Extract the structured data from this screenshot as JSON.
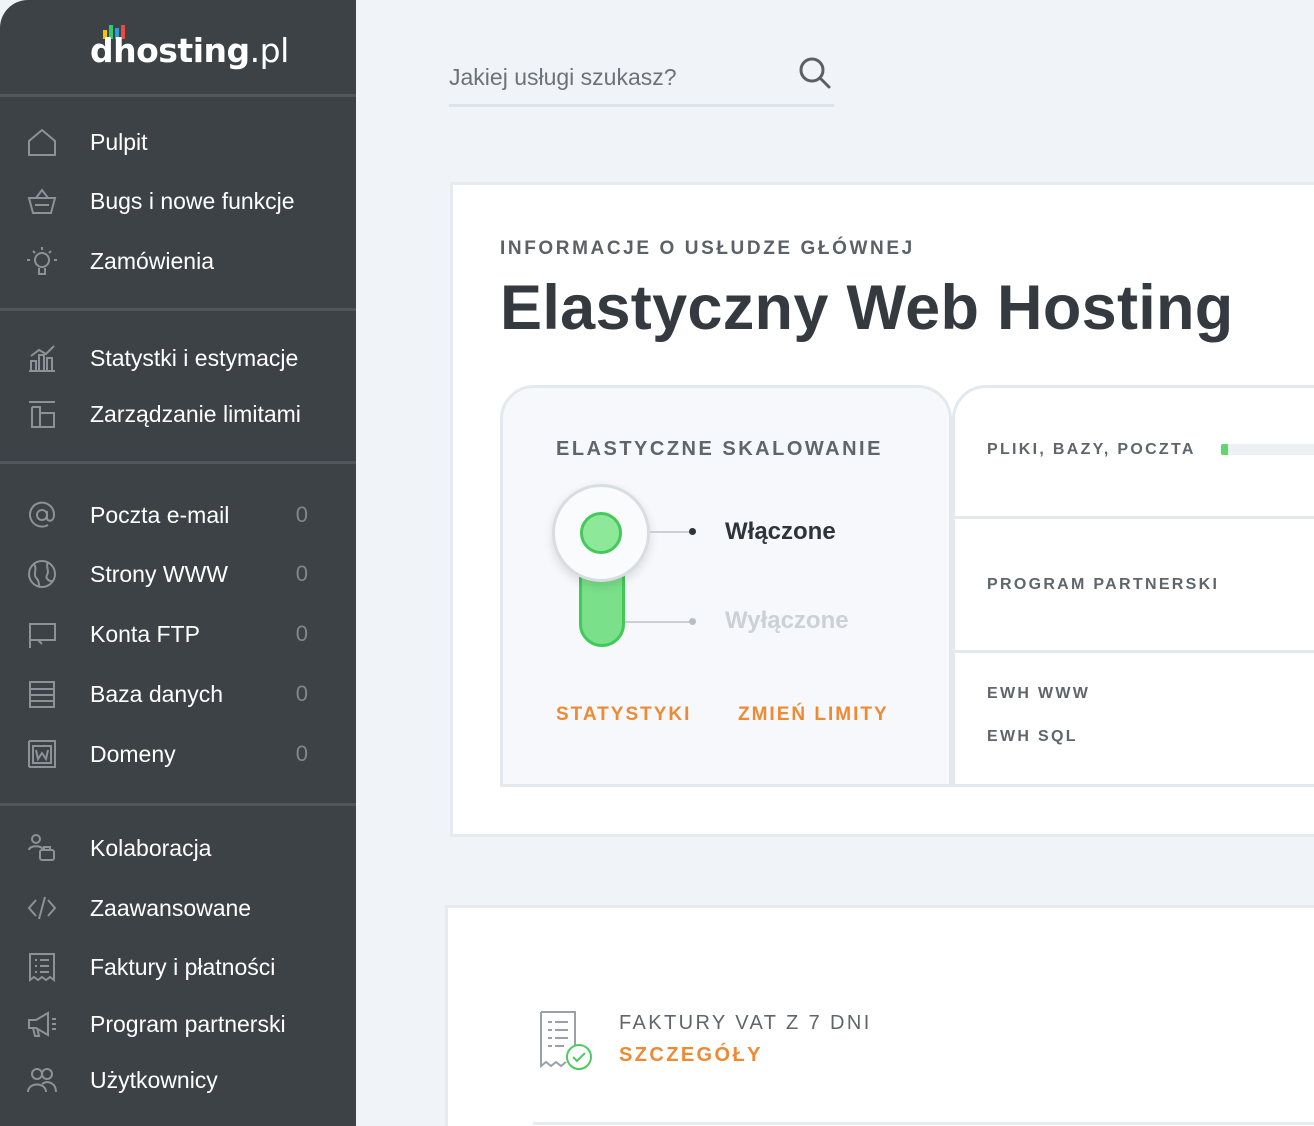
{
  "brand": {
    "logo_main": "dhosting",
    "logo_suffix": ".pl",
    "bar_colors": [
      "#f5c300",
      "#2ecc71",
      "#3498db",
      "#e74c3c"
    ]
  },
  "search": {
    "placeholder": "Jakiej usługi szukasz?"
  },
  "sidebar": {
    "group1": [
      {
        "label": "Pulpit",
        "icon": "home-icon"
      },
      {
        "label": "Bugs i nowe funkcje",
        "icon": "basket-icon"
      },
      {
        "label": "Zamówienia",
        "icon": "lightbulb-icon"
      }
    ],
    "group2": [
      {
        "label": "Statystki i estymacje",
        "icon": "chart-icon"
      },
      {
        "label": "Zarządzanie limitami",
        "icon": "limits-icon"
      }
    ],
    "group3": [
      {
        "label": "Poczta e-mail",
        "icon": "at-icon",
        "count": "0"
      },
      {
        "label": "Strony WWW",
        "icon": "globe-icon",
        "count": "0"
      },
      {
        "label": "Konta FTP",
        "icon": "ftp-icon",
        "count": "0"
      },
      {
        "label": "Baza danych",
        "icon": "database-icon",
        "count": "0"
      },
      {
        "label": "Domeny",
        "icon": "domain-icon",
        "count": "0"
      }
    ],
    "group4": [
      {
        "label": "Kolaboracja",
        "icon": "collaboration-icon"
      },
      {
        "label": "Zaawansowane",
        "icon": "code-icon"
      },
      {
        "label": "Faktury i płatności",
        "icon": "invoice-icon"
      },
      {
        "label": "Program partnerski",
        "icon": "megaphone-icon"
      },
      {
        "label": "Użytkownicy",
        "icon": "users-icon"
      }
    ]
  },
  "service": {
    "eyebrow": "INFORMACJE O USŁUDZE GŁÓWNEJ",
    "title": "Elastyczny Web Hosting"
  },
  "scaling": {
    "title": "ELASTYCZNE SKALOWANIE",
    "on_label": "Włączone",
    "off_label": "Wyłączone",
    "state": "on",
    "stats_link": "STATYSTYKI",
    "limits_link": "ZMIEŃ LIMITY",
    "accent": "#ee8a34"
  },
  "side_panels": {
    "usage_label": "PLIKI, BAZY, POCZTA",
    "usage_fraction": 0.06,
    "partner_label": "PROGRAM PARTNERSKI",
    "ewh_www": "EWH WWW",
    "ewh_sql": "EWH SQL"
  },
  "invoices": {
    "title": "FAKTURY VAT Z 7 DNI",
    "link": "SZCZEGÓŁY"
  }
}
